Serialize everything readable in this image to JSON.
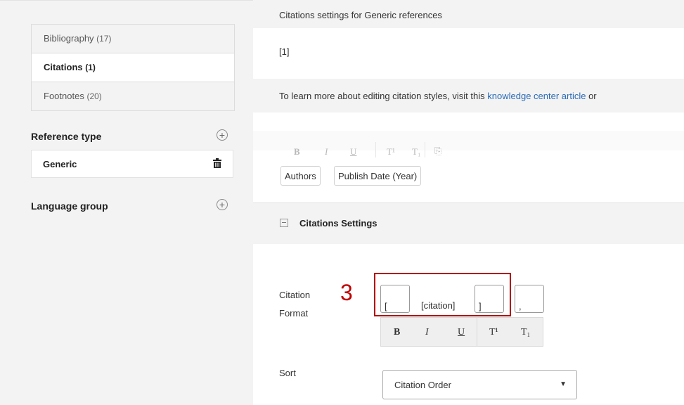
{
  "sidebar": {
    "doc_tabs": [
      {
        "label": "Bibliography",
        "count": "(17)"
      },
      {
        "label": "Citations",
        "count": "(1)"
      },
      {
        "label": "Footnotes",
        "count": "(20)"
      }
    ],
    "reference_type_label": "Reference type",
    "reference_items": [
      {
        "label": "Generic"
      }
    ],
    "language_group_label": "Language group"
  },
  "main": {
    "header": "Citations settings for Generic references",
    "preview": "[1]",
    "info_text": "To learn more about editing citation styles, visit this ",
    "info_link": "knowledge center article",
    "info_tail": " or",
    "top_toolbar": {
      "bold": "B",
      "italic": "I",
      "underline": "U",
      "superscript": "T¹",
      "subscript": "T₁"
    },
    "fields": [
      "Authors",
      "Publish Date (Year)"
    ],
    "settings_title": "Citations Settings",
    "citation_format": {
      "label_line1": "Citation",
      "label_line2": "Format",
      "open": "[",
      "token": "[citation]",
      "close": "]",
      "separator": ","
    },
    "format_toolbar": {
      "bold": "B",
      "italic": "I",
      "underline": "U",
      "superscript": "T¹",
      "subscript": "T₁"
    },
    "sort_label": "Sort",
    "sort_value": "Citation Order",
    "step_marker": "3"
  },
  "colors": {
    "accent_link": "#2a6ab8",
    "highlight": "#b00000"
  }
}
